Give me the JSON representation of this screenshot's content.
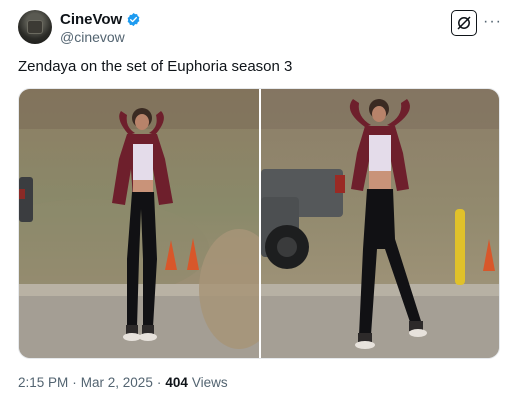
{
  "author": {
    "display_name": "CineVow",
    "handle": "@cinevow",
    "verified_badge_color": "#1d9bf0",
    "avatar_icon": "avatar-icon"
  },
  "header_actions": {
    "grok_icon": "grok-icon",
    "more_icon": "more-dots-icon",
    "more_glyph": "···"
  },
  "post": {
    "text": "Zendaya on the set of Euphoria season 3"
  },
  "media": {
    "photo_count": 2
  },
  "meta": {
    "time": "2:15 PM",
    "separator": "·",
    "date": "Mar 2, 2025",
    "views_count": "404",
    "views_label": "Views"
  }
}
